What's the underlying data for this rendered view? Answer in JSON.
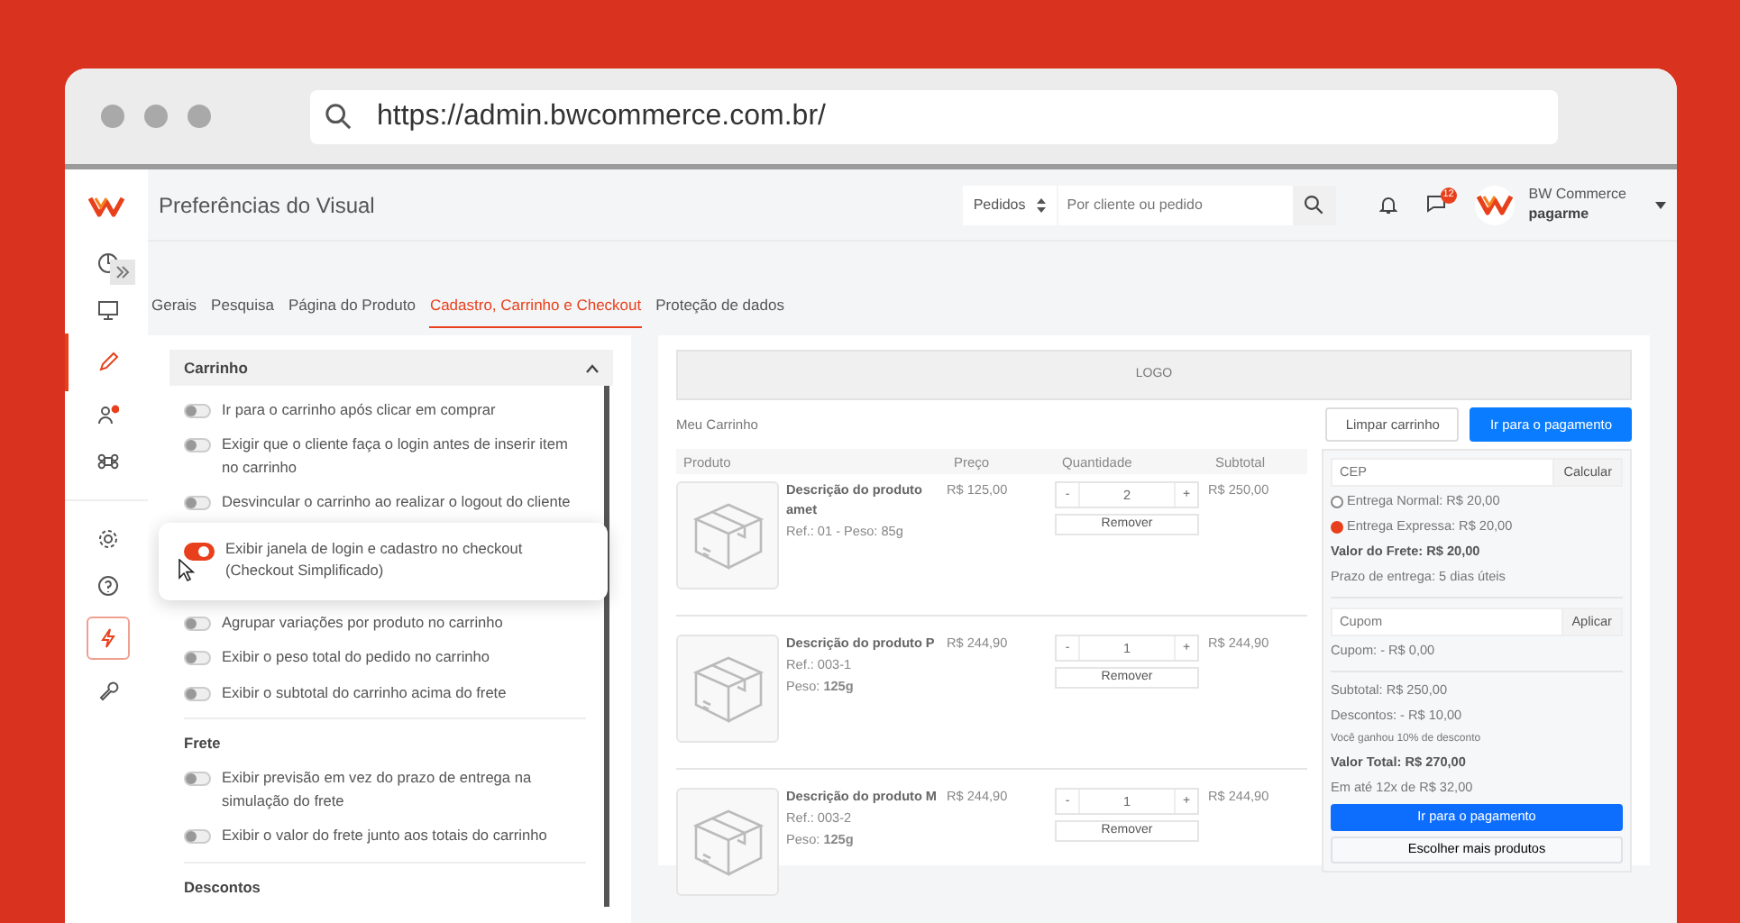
{
  "browser": {
    "url": "https://admin.bwcommerce.com.br/"
  },
  "sidebar": {
    "items": [
      {
        "selected": false,
        "outlined": false
      },
      {
        "selected": false,
        "outlined": false
      },
      {
        "selected": true,
        "outlined": false
      },
      {
        "selected": false,
        "outlined": false
      },
      {
        "selected": false,
        "outlined": false
      },
      {
        "selected": false,
        "outlined": false
      },
      {
        "selected": false,
        "outlined": false
      },
      {
        "selected": false,
        "outlined": true
      },
      {
        "selected": false,
        "outlined": false
      }
    ]
  },
  "header": {
    "title": "Preferências do Visual",
    "search_scope": "Pedidos",
    "search": {
      "placeholder": "Por cliente ou pedido"
    },
    "messages_badge": "12",
    "account": {
      "name": "BW Commerce",
      "store": "pagarme"
    }
  },
  "tabs": [
    {
      "label": "Gerais",
      "selected": false
    },
    {
      "label": "Pesquisa",
      "selected": false
    },
    {
      "label": "Página do Produto",
      "selected": false
    },
    {
      "label": "Cadastro, Carrinho e Checkout",
      "selected": true
    },
    {
      "label": "Proteção de dados",
      "selected": false
    }
  ],
  "settings": {
    "panel_title": "Carrinho",
    "expanded": true,
    "sections": [
      {
        "items": [
          {
            "label": "Ir para o carrinho após clicar em comprar",
            "on": false,
            "highlighted": false
          },
          {
            "label": "Exigir que o cliente faça o login antes de inserir item no carrinho",
            "on": false,
            "highlighted": false
          },
          {
            "label": "Desvincular o carrinho ao realizar o logout do cliente",
            "on": false,
            "highlighted": false
          },
          {
            "label": "Exibir janela de login e cadastro no checkout (Checkout Simplificado)",
            "on": true,
            "highlighted": true
          },
          {
            "label": "Agrupar variações por produto no carrinho",
            "on": false,
            "highlighted": false
          },
          {
            "label": "Exibir o peso total do pedido no carrinho",
            "on": false,
            "highlighted": false
          },
          {
            "label": "Exibir o subtotal do carrinho acima do frete",
            "on": false,
            "highlighted": false
          }
        ]
      },
      {
        "title": "Frete",
        "items": [
          {
            "label": "Exibir previsão em vez do prazo de entrega na simulação do frete",
            "on": false,
            "highlighted": false
          },
          {
            "label": "Exibir o valor do frete junto aos totais do carrinho",
            "on": false,
            "highlighted": false
          }
        ]
      },
      {
        "title": "Descontos"
      }
    ]
  },
  "preview": {
    "logo": "LOGO",
    "cart_title": "Meu Carrinho",
    "clear_button": "Limpar carrinho",
    "pay_button": "Ir para o pagamento",
    "columns": [
      "Produto",
      "Preço",
      "Quantidade",
      "Subtotal"
    ],
    "rows": [
      {
        "name": "Descrição do produto amet",
        "details": [
          "Ref.: 01 - Peso: 85g"
        ],
        "price": "R$ 125,00",
        "quantity": "2",
        "subtotal": "R$ 250,00",
        "remove": "Remover"
      },
      {
        "name": "Descrição do produto P",
        "details": [
          "Ref.: 003-1",
          "Peso: **125g**"
        ],
        "price": "R$ 244,90",
        "quantity": "1",
        "subtotal": "R$ 244,90",
        "remove": "Remover"
      },
      {
        "name": "Descrição do produto M",
        "details": [
          "Ref.: 003-2",
          "Peso: **125g**"
        ],
        "price": "R$ 244,90",
        "quantity": "1",
        "subtotal": "R$ 244,90",
        "remove": "Remover"
      }
    ],
    "qty_minus": "-",
    "qty_plus": "+",
    "summary": {
      "cep": {
        "placeholder": "CEP"
      },
      "calc_button": "Calcular",
      "shipping": [
        {
          "label": "Entrega Normal: R$ 20,00",
          "selected": false
        },
        {
          "label": "Entrega Expressa: R$ 20,00",
          "selected": true
        }
      ],
      "shipping_lines": [
        {
          "kind": "bold",
          "text": "Valor do Frete: R$ 20,00"
        },
        {
          "kind": "normal",
          "text": "Prazo de entrega: 5 dias úteis"
        }
      ],
      "coupon": {
        "placeholder": "Cupom"
      },
      "apply_button": "Aplicar",
      "coupon_line": "Cupom: - R$ 0,00",
      "totals": [
        {
          "kind": "normal",
          "text": "Subtotal: R$ 250,00"
        },
        {
          "kind": "normal",
          "text": "Descontos: - R$ 10,00"
        },
        {
          "kind": "small",
          "text": "Você ganhou 10% de desconto"
        },
        {
          "kind": "bold",
          "text": "Valor Total: R$ 270,00"
        },
        {
          "kind": "normal",
          "text": "Em até 12x de R$ 32,00"
        }
      ],
      "pay_button": "Ir para o pagamento",
      "more_button": "Escolher mais produtos"
    }
  }
}
